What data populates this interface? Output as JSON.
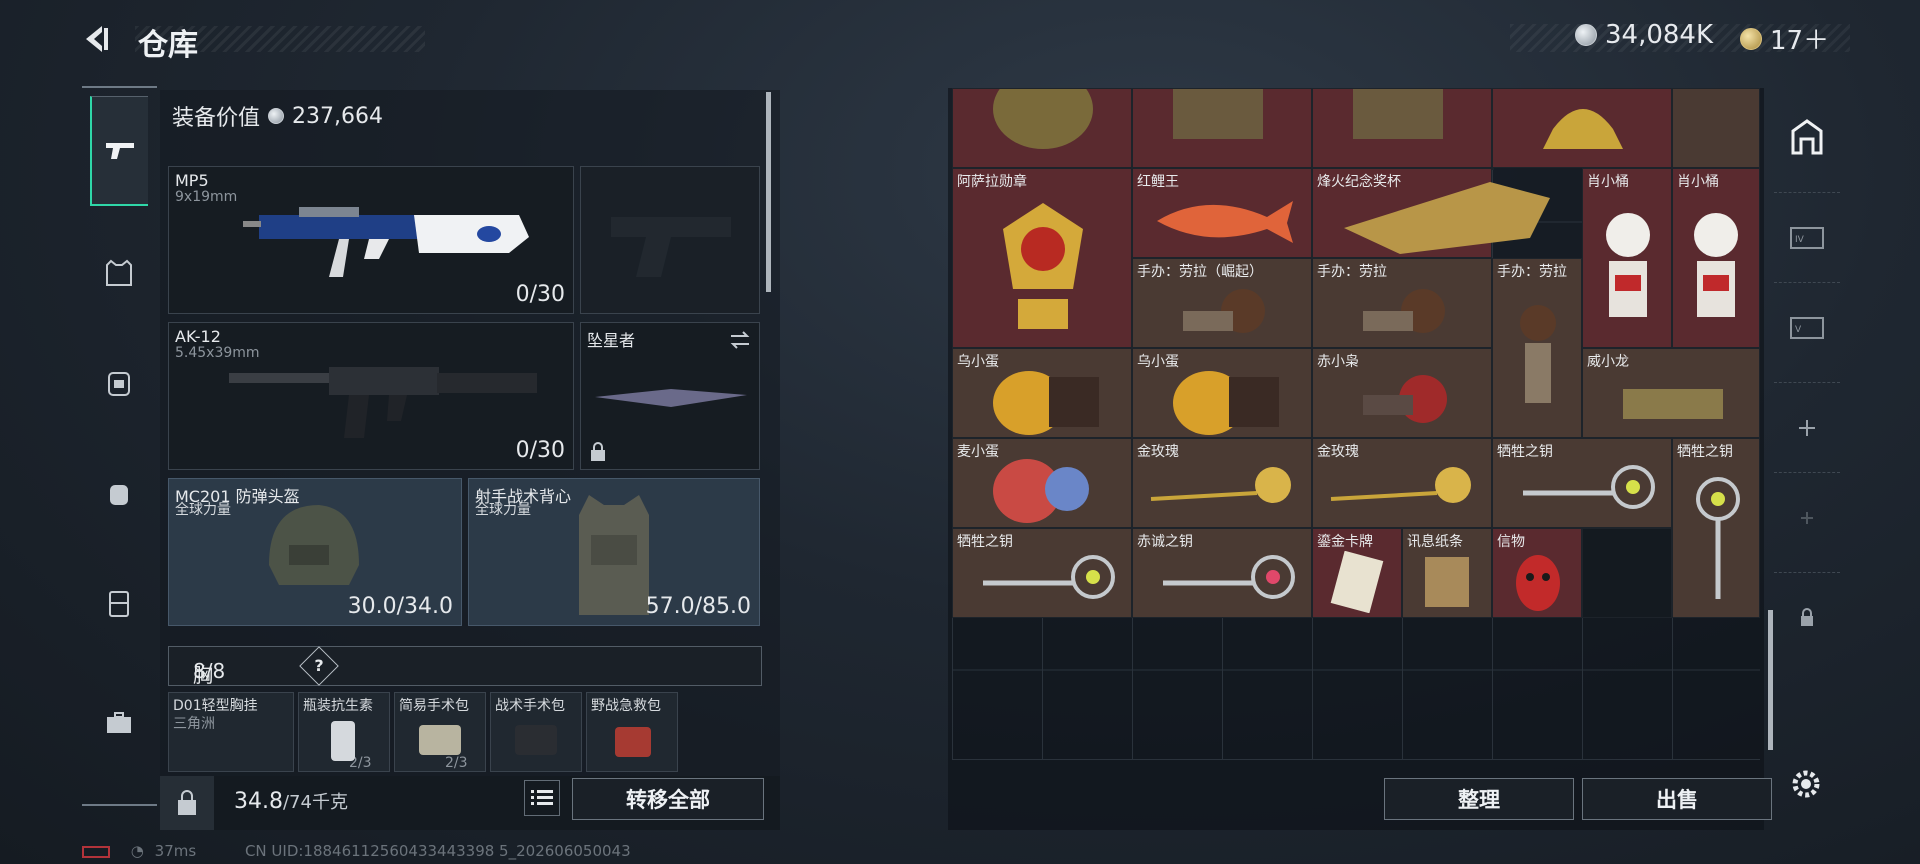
{
  "header": {
    "title": "仓库",
    "currency1": "34,084K",
    "currency2": "17＋"
  },
  "nav": [
    "weapons",
    "equipment",
    "backpack",
    "bag",
    "case",
    "tools"
  ],
  "equip_value": {
    "label": "装备价值",
    "value": "237,664"
  },
  "weapons": {
    "primary": {
      "name": "MP5",
      "caliber": "9x19mm",
      "ammo": "0/30"
    },
    "secondary": {
      "name": "AK-12",
      "caliber": "5.45x39mm",
      "ammo": "0/30"
    },
    "melee": {
      "name": "坠星者"
    }
  },
  "armor": {
    "helmet": {
      "name": "MC201 防弹头盔",
      "sub": "全球力量",
      "durability": "30.0/34.0"
    },
    "vest": {
      "name": "射手战术背心",
      "sub": "全球力量",
      "durability": "57.0/85.0"
    }
  },
  "chest_rig": {
    "label": "胸挂：",
    "count": "8/8",
    "help": "?"
  },
  "rig_items": [
    {
      "name": "D01轻型胸挂",
      "sub": "三角洲"
    },
    {
      "name": "瓶装抗生素",
      "sub": "2/3"
    },
    {
      "name": "简易手术包",
      "sub": "2/3"
    },
    {
      "name": "战术手术包",
      "sub": ""
    },
    {
      "name": "野战急救包",
      "sub": ""
    }
  ],
  "bottom": {
    "weight_value": "34.8",
    "weight_max": "/74千克",
    "transfer_all": "转移全部",
    "sort": "整理",
    "sell": "出售"
  },
  "stash_items": [
    {
      "label": "阿萨拉勋章"
    },
    {
      "label": "红鲤王"
    },
    {
      "label": "烽火纪念奖杯"
    },
    {
      "label": "肖小桶"
    },
    {
      "label": "肖小桶"
    },
    {
      "label": "手办：劳拉（崛起）"
    },
    {
      "label": "手办：劳拉"
    },
    {
      "label": "手办：劳拉"
    },
    {
      "label": "乌小蛋"
    },
    {
      "label": "乌小蛋"
    },
    {
      "label": "赤小枭"
    },
    {
      "label": "威小龙"
    },
    {
      "label": "麦小蛋"
    },
    {
      "label": "金玫瑰"
    },
    {
      "label": "金玫瑰"
    },
    {
      "label": "牺牲之钥"
    },
    {
      "label": "牺牲之钥"
    },
    {
      "label": "牺牲之钥"
    },
    {
      "label": "赤诚之钥"
    },
    {
      "label": "鎏金卡牌"
    },
    {
      "label": "讯息纸条"
    },
    {
      "label": "信物"
    }
  ],
  "status": {
    "ping": "37ms",
    "uid": "CN UID:18846112560433443398 5_202606050043"
  }
}
